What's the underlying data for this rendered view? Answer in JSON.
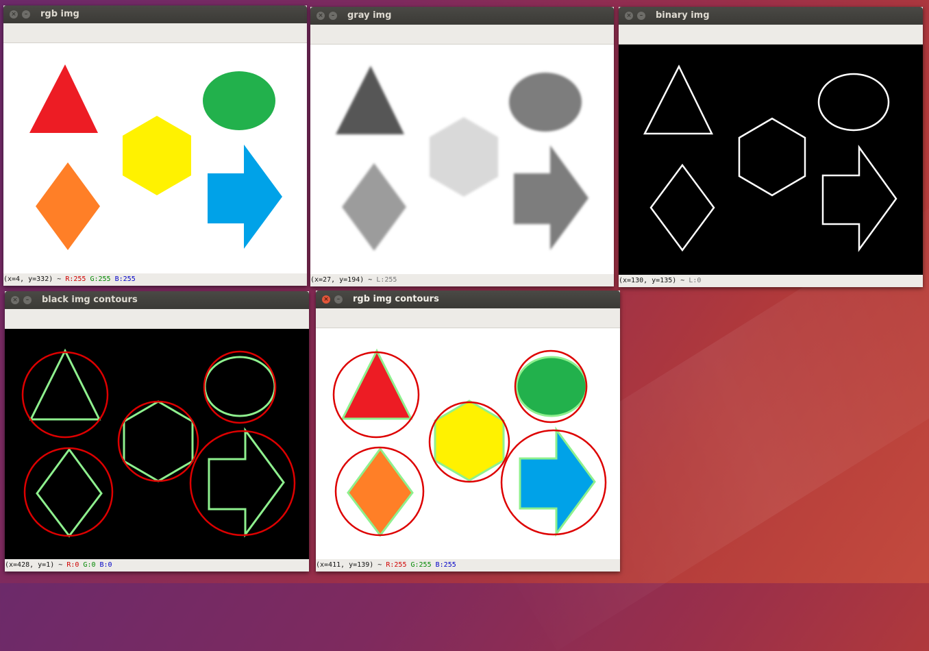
{
  "windows": {
    "rgb": {
      "title": "rgb img",
      "coords": "(x=4, y=332) ~",
      "r": "R:255",
      "g": "G:255",
      "b": "B:255"
    },
    "gray": {
      "title": "gray img",
      "coords": "(x=27, y=194) ~",
      "l": "L:255"
    },
    "binary": {
      "title": "binary img",
      "coords": "(x=130, y=135) ~",
      "l": "L:0"
    },
    "black_contours": {
      "title": "black img contours",
      "coords": "(x=428, y=1) ~",
      "r": "R:0",
      "g": "G:0",
      "b": "B:0"
    },
    "rgb_contours": {
      "title": "rgb img contours",
      "coords": "(x=411, y=139) ~",
      "r": "R:255",
      "g": "G:255",
      "b": "B:255"
    }
  },
  "buttons": {
    "close_glyph": "×",
    "min_glyph": "–"
  },
  "colors": {
    "red": "#ed1c24",
    "green": "#22b14c",
    "yellow": "#fff200",
    "orange": "#ff7f27",
    "blue": "#00a2e8",
    "contour_green": "#8ef08e",
    "enclosing_circle": "#dd0000",
    "gray_dark": "#575757",
    "gray_mid": "#7d7d7d",
    "gray_light": "#d9d9d9",
    "gray_diamond": "#9c9c9c"
  },
  "shapes": [
    "triangle",
    "ellipse",
    "hexagon",
    "diamond",
    "arrow"
  ]
}
